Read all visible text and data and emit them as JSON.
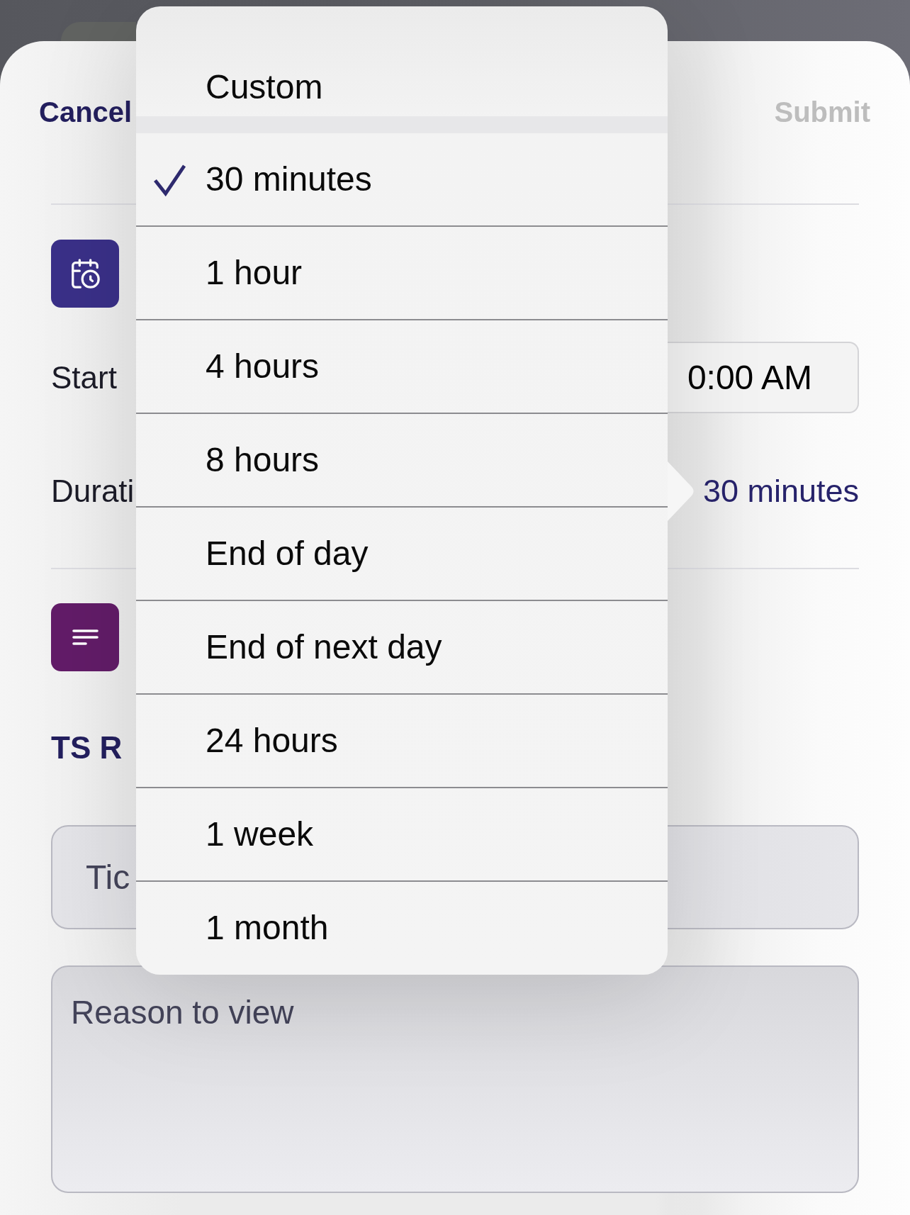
{
  "navigation": {
    "cancel": {
      "label": "Cancel"
    },
    "submit": {
      "label": "Submit",
      "disabled": true
    }
  },
  "schedule": {
    "start": {
      "label": "Start",
      "value": "0:00 AM"
    },
    "duration": {
      "label": "Durati",
      "value": "30 minutes"
    }
  },
  "details": {
    "title": "TS R",
    "ticket_field": {
      "placeholder": "Tic"
    },
    "reason_field": {
      "placeholder": "Reason to view"
    }
  },
  "duration_menu": {
    "groups": [
      {
        "items": [
          {
            "label": "Custom",
            "selected": false
          }
        ]
      },
      {
        "items": [
          {
            "label": "30 minutes",
            "selected": true
          },
          {
            "label": "1 hour",
            "selected": false
          },
          {
            "label": "4 hours",
            "selected": false
          },
          {
            "label": "8 hours",
            "selected": false
          },
          {
            "label": "End of day",
            "selected": false
          },
          {
            "label": "End of next day",
            "selected": false
          },
          {
            "label": "24 hours",
            "selected": false
          },
          {
            "label": "1 week",
            "selected": false
          },
          {
            "label": "1 month",
            "selected": false
          }
        ]
      }
    ]
  }
}
